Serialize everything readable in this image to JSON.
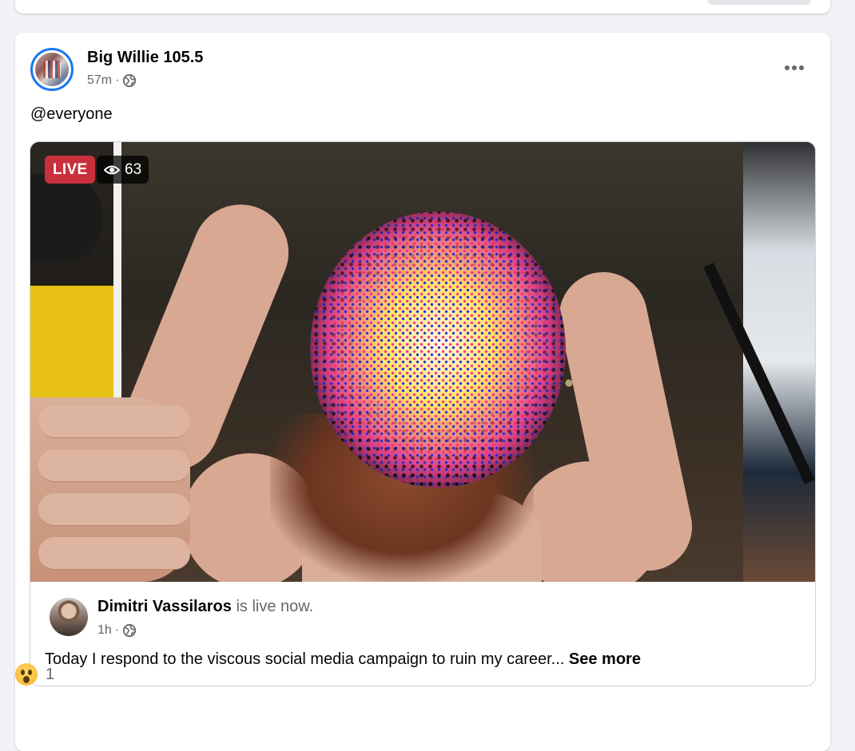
{
  "post": {
    "author": "Big Willie 105.5",
    "time": "57m",
    "separator": "·",
    "text": "@everyone",
    "icons": {
      "audience": "globe-icon",
      "menu": "more-options-icon"
    }
  },
  "video": {
    "live_label": "LIVE",
    "viewer_count": "63",
    "viewer_icon": "eye-icon",
    "live_color": "#c9303c"
  },
  "shared": {
    "name": "Dimitri Vassilaros",
    "status": "is live now.",
    "time": "1h",
    "separator": "·",
    "description": "Today I respond to the viscous social media campaign to ruin my career...",
    "see_more": "See more"
  },
  "reactions": {
    "icon": "wow-reaction-icon",
    "count": "1"
  },
  "colors": {
    "accent": "#1877f2",
    "background": "#f0f2f5",
    "secondary_text": "#65676b"
  }
}
